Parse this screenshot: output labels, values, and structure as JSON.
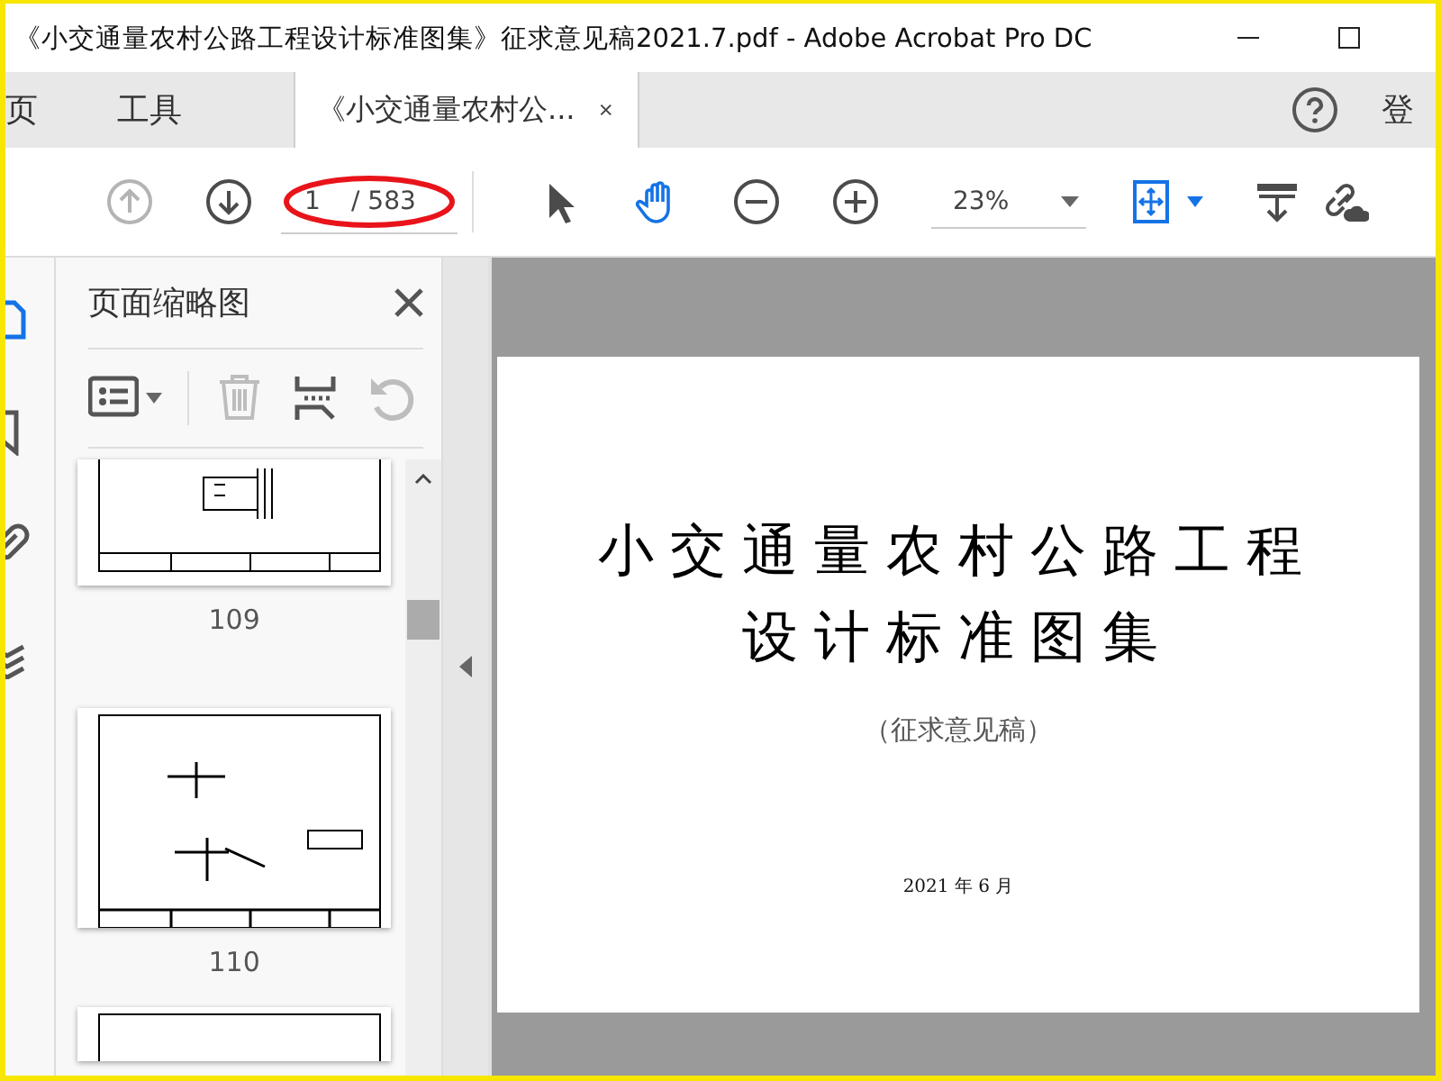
{
  "window": {
    "title": "《小交通量农村公路工程设计标准图集》征求意见稿2021.7.pdf - Adobe Acrobat Pro DC"
  },
  "tabs": [
    {
      "label": "页",
      "kind": "nav",
      "selected": false
    },
    {
      "label": "工具",
      "kind": "nav",
      "selected": false
    },
    {
      "label": "《小交通量农村公...",
      "kind": "document",
      "selected": true
    }
  ],
  "sign_in": "登",
  "toolbar": {
    "page_current": "1",
    "page_total": "/ 583",
    "zoom": "23%",
    "buttons": [
      {
        "kind": "prev-page",
        "disabled": true
      },
      {
        "kind": "next-page",
        "disabled": false
      },
      {
        "kind": "page-field"
      },
      {
        "kind": "select-tool",
        "selected": false
      },
      {
        "kind": "hand-tool",
        "selected": true
      },
      {
        "kind": "zoom-out"
      },
      {
        "kind": "zoom-in"
      },
      {
        "kind": "zoom-menu"
      },
      {
        "kind": "fit-page"
      },
      {
        "kind": "scroll-mode"
      },
      {
        "kind": "share-link"
      }
    ]
  },
  "rail": [
    {
      "kind": "pages",
      "selected": true
    },
    {
      "kind": "bookmarks",
      "selected": false
    },
    {
      "kind": "attachments",
      "selected": false
    },
    {
      "kind": "layers",
      "selected": false
    }
  ],
  "sidebar": {
    "title": "页面缩略图",
    "tools": [
      {
        "kind": "options",
        "disabled": false
      },
      {
        "kind": "delete",
        "disabled": true
      },
      {
        "kind": "insert",
        "disabled": false
      },
      {
        "kind": "undo",
        "disabled": true
      }
    ],
    "thumbnails": [
      {
        "label": "109",
        "kind": "cut-top"
      },
      {
        "label": "110",
        "kind": "full"
      },
      {
        "kind": "cut-bottom"
      }
    ]
  },
  "document": {
    "title_lines": [
      "小交通量农村公路工程",
      "设计标准图集"
    ],
    "subtitle": "（征求意见稿）",
    "date": "2021 年 6 月"
  }
}
